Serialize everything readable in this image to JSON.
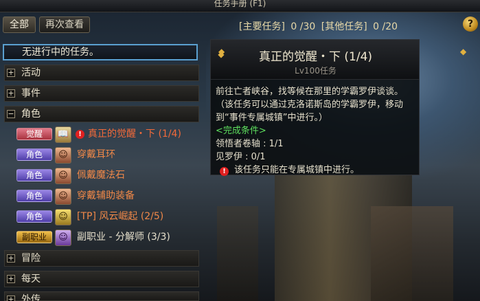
{
  "window": {
    "title": "任务手册 (F1)"
  },
  "tabs": {
    "all": "全部",
    "again": "再次查看"
  },
  "counters": {
    "main_label": "[主要任务]",
    "main_value": "0 /30",
    "other_label": "[其他任务]",
    "other_value": "0 /20"
  },
  "help": "?",
  "list": {
    "no_quest": "无进行中的任务。",
    "categories": {
      "activity": {
        "toggle": "+",
        "label": "活动"
      },
      "event": {
        "toggle": "+",
        "label": "事件"
      },
      "role": {
        "toggle": "−",
        "label": "角色"
      },
      "adventure": {
        "toggle": "+",
        "label": "冒险"
      },
      "daily": {
        "toggle": "+",
        "label": "每天"
      },
      "extra": {
        "toggle": "+",
        "label": "外传"
      }
    },
    "items": [
      {
        "tag": "觉醒",
        "avatar": "📖",
        "name": "真正的觉醒・下 (1/4)"
      },
      {
        "tag": "角色",
        "avatar": "☺",
        "name": "穿戴耳环"
      },
      {
        "tag": "角色",
        "avatar": "☺",
        "name": "佩戴魔法石"
      },
      {
        "tag": "角色",
        "avatar": "☺",
        "name": "穿戴辅助装备"
      },
      {
        "tag": "角色",
        "avatar": "☺",
        "name": "[TP] 风云崛起 (2/5)"
      },
      {
        "tag": "副职业",
        "avatar": "☺",
        "name": "副职业 - 分解师 (3/3)"
      }
    ]
  },
  "detail": {
    "title": "真正的觉醒・下 (1/4)",
    "level": "Lv100任务",
    "desc1": "前往亡者峡谷，找等候在那里的学霸罗伊谈谈。",
    "desc2": "（该任务可以通过克洛诺斯岛的学霸罗伊，移动到“事件专属城镇”中进行。）",
    "cond_label": "<完成条件>",
    "cond1": "领悟者卷轴 : 1/1",
    "cond2": "见罗伊 : 0/1",
    "note": "该任务只能在专属城镇中进行。"
  }
}
